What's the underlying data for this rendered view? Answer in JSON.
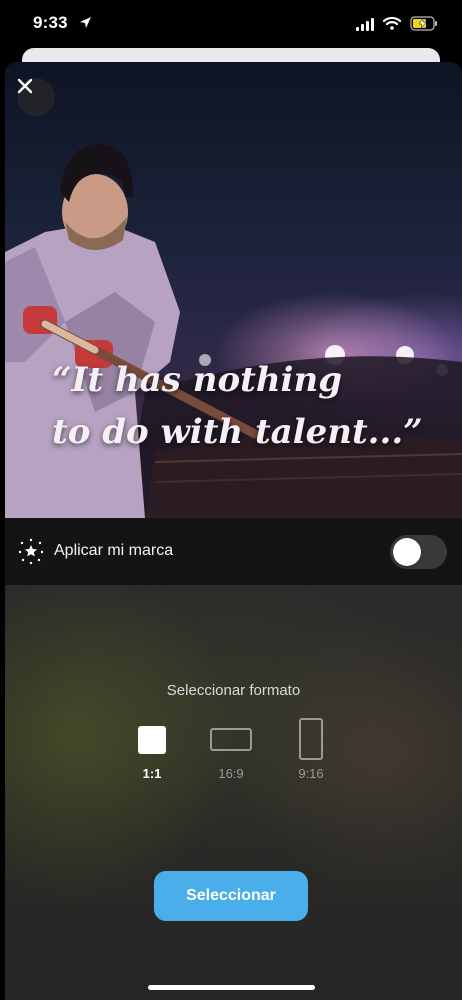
{
  "status_bar": {
    "time": "9:33",
    "icons": [
      "location-arrow-icon",
      "signal-icon",
      "wifi-icon",
      "battery-charging-icon"
    ]
  },
  "preview": {
    "quote_line1": "“It has nothing",
    "quote_line2": "to do with talent...”",
    "close_icon": "close-icon"
  },
  "brand": {
    "label": "Aplicar mi marca",
    "icon": "sparkle-star-icon",
    "toggle_on": false
  },
  "format": {
    "title": "Seleccionar formato",
    "options": [
      {
        "label": "1:1",
        "selected": true
      },
      {
        "label": "16:9",
        "selected": false
      },
      {
        "label": "9:16",
        "selected": false
      }
    ]
  },
  "actions": {
    "select_label": "Seleccionar"
  },
  "colors": {
    "accent": "#4aaeea",
    "sheet": "#1c1c1e",
    "battery": "#f5d315"
  }
}
